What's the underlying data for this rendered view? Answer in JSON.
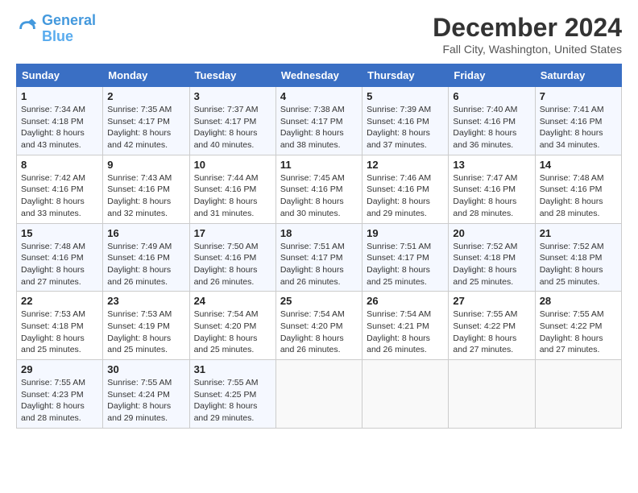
{
  "logo": {
    "line1": "General",
    "line2": "Blue"
  },
  "title": "December 2024",
  "subtitle": "Fall City, Washington, United States",
  "days_header": [
    "Sunday",
    "Monday",
    "Tuesday",
    "Wednesday",
    "Thursday",
    "Friday",
    "Saturday"
  ],
  "weeks": [
    [
      {
        "day": "1",
        "info": "Sunrise: 7:34 AM\nSunset: 4:18 PM\nDaylight: 8 hours\nand 43 minutes."
      },
      {
        "day": "2",
        "info": "Sunrise: 7:35 AM\nSunset: 4:17 PM\nDaylight: 8 hours\nand 42 minutes."
      },
      {
        "day": "3",
        "info": "Sunrise: 7:37 AM\nSunset: 4:17 PM\nDaylight: 8 hours\nand 40 minutes."
      },
      {
        "day": "4",
        "info": "Sunrise: 7:38 AM\nSunset: 4:17 PM\nDaylight: 8 hours\nand 38 minutes."
      },
      {
        "day": "5",
        "info": "Sunrise: 7:39 AM\nSunset: 4:16 PM\nDaylight: 8 hours\nand 37 minutes."
      },
      {
        "day": "6",
        "info": "Sunrise: 7:40 AM\nSunset: 4:16 PM\nDaylight: 8 hours\nand 36 minutes."
      },
      {
        "day": "7",
        "info": "Sunrise: 7:41 AM\nSunset: 4:16 PM\nDaylight: 8 hours\nand 34 minutes."
      }
    ],
    [
      {
        "day": "8",
        "info": "Sunrise: 7:42 AM\nSunset: 4:16 PM\nDaylight: 8 hours\nand 33 minutes."
      },
      {
        "day": "9",
        "info": "Sunrise: 7:43 AM\nSunset: 4:16 PM\nDaylight: 8 hours\nand 32 minutes."
      },
      {
        "day": "10",
        "info": "Sunrise: 7:44 AM\nSunset: 4:16 PM\nDaylight: 8 hours\nand 31 minutes."
      },
      {
        "day": "11",
        "info": "Sunrise: 7:45 AM\nSunset: 4:16 PM\nDaylight: 8 hours\nand 30 minutes."
      },
      {
        "day": "12",
        "info": "Sunrise: 7:46 AM\nSunset: 4:16 PM\nDaylight: 8 hours\nand 29 minutes."
      },
      {
        "day": "13",
        "info": "Sunrise: 7:47 AM\nSunset: 4:16 PM\nDaylight: 8 hours\nand 28 minutes."
      },
      {
        "day": "14",
        "info": "Sunrise: 7:48 AM\nSunset: 4:16 PM\nDaylight: 8 hours\nand 28 minutes."
      }
    ],
    [
      {
        "day": "15",
        "info": "Sunrise: 7:48 AM\nSunset: 4:16 PM\nDaylight: 8 hours\nand 27 minutes."
      },
      {
        "day": "16",
        "info": "Sunrise: 7:49 AM\nSunset: 4:16 PM\nDaylight: 8 hours\nand 26 minutes."
      },
      {
        "day": "17",
        "info": "Sunrise: 7:50 AM\nSunset: 4:16 PM\nDaylight: 8 hours\nand 26 minutes."
      },
      {
        "day": "18",
        "info": "Sunrise: 7:51 AM\nSunset: 4:17 PM\nDaylight: 8 hours\nand 26 minutes."
      },
      {
        "day": "19",
        "info": "Sunrise: 7:51 AM\nSunset: 4:17 PM\nDaylight: 8 hours\nand 25 minutes."
      },
      {
        "day": "20",
        "info": "Sunrise: 7:52 AM\nSunset: 4:18 PM\nDaylight: 8 hours\nand 25 minutes."
      },
      {
        "day": "21",
        "info": "Sunrise: 7:52 AM\nSunset: 4:18 PM\nDaylight: 8 hours\nand 25 minutes."
      }
    ],
    [
      {
        "day": "22",
        "info": "Sunrise: 7:53 AM\nSunset: 4:18 PM\nDaylight: 8 hours\nand 25 minutes."
      },
      {
        "day": "23",
        "info": "Sunrise: 7:53 AM\nSunset: 4:19 PM\nDaylight: 8 hours\nand 25 minutes."
      },
      {
        "day": "24",
        "info": "Sunrise: 7:54 AM\nSunset: 4:20 PM\nDaylight: 8 hours\nand 25 minutes."
      },
      {
        "day": "25",
        "info": "Sunrise: 7:54 AM\nSunset: 4:20 PM\nDaylight: 8 hours\nand 26 minutes."
      },
      {
        "day": "26",
        "info": "Sunrise: 7:54 AM\nSunset: 4:21 PM\nDaylight: 8 hours\nand 26 minutes."
      },
      {
        "day": "27",
        "info": "Sunrise: 7:55 AM\nSunset: 4:22 PM\nDaylight: 8 hours\nand 27 minutes."
      },
      {
        "day": "28",
        "info": "Sunrise: 7:55 AM\nSunset: 4:22 PM\nDaylight: 8 hours\nand 27 minutes."
      }
    ],
    [
      {
        "day": "29",
        "info": "Sunrise: 7:55 AM\nSunset: 4:23 PM\nDaylight: 8 hours\nand 28 minutes."
      },
      {
        "day": "30",
        "info": "Sunrise: 7:55 AM\nSunset: 4:24 PM\nDaylight: 8 hours\nand 29 minutes."
      },
      {
        "day": "31",
        "info": "Sunrise: 7:55 AM\nSunset: 4:25 PM\nDaylight: 8 hours\nand 29 minutes."
      },
      {
        "day": "",
        "info": ""
      },
      {
        "day": "",
        "info": ""
      },
      {
        "day": "",
        "info": ""
      },
      {
        "day": "",
        "info": ""
      }
    ]
  ]
}
